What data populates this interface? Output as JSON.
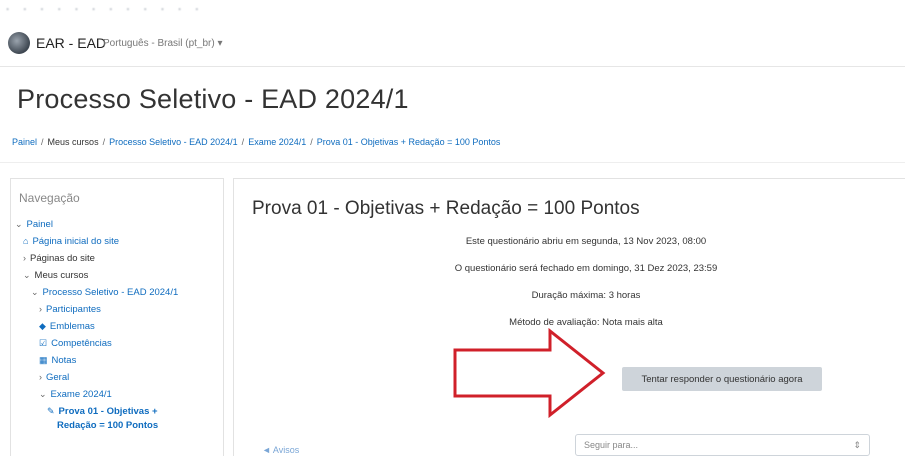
{
  "site": {
    "name": "EAR - EAD",
    "language": "Português - Brasil (pt_br) ▾"
  },
  "page": {
    "title": "Processo Seletivo - EAD 2024/1"
  },
  "breadcrumb": {
    "items": [
      "Painel",
      "Meus cursos",
      "Processo Seletivo - EAD 2024/1",
      "Exame 2024/1",
      "Prova 01 - Objetivas + Redação = 100 Pontos"
    ]
  },
  "navigation": {
    "title": "Navegação",
    "painel": "Painel",
    "home": "Página inicial do site",
    "site_pages": "Páginas do site",
    "my_courses": "Meus cursos",
    "course": "Processo Seletivo - EAD 2024/1",
    "participants": "Participantes",
    "badges": "Emblemas",
    "competencies": "Competências",
    "grades": "Notas",
    "general": "Geral",
    "exam": "Exame 2024/1",
    "current_line1": "Prova 01 - Objetivas +",
    "current_line2": "Redação = 100 Pontos"
  },
  "quiz": {
    "title": "Prova 01 - Objetivas + Redação = 100 Pontos",
    "opened": "Este questionário abriu em segunda, 13 Nov 2023, 08:00",
    "closes": "O questionário será fechado em domingo, 31 Dez 2023, 23:59",
    "time_limit": "Duração máxima: 3 horas",
    "grading": "Método de avaliação: Nota mais alta",
    "attempt_button": "Tentar responder o questionário agora",
    "previous_link": "◄ Avisos",
    "jump_placeholder": "Seguir para...",
    "jump_caret": "⇕"
  },
  "colors": {
    "link": "#0f6cbf",
    "button_bg": "#ced4da",
    "arrow_stroke": "#d0202a"
  },
  "icons": {
    "arrow": "red-outline-arrow-icon",
    "home": "home-icon"
  }
}
